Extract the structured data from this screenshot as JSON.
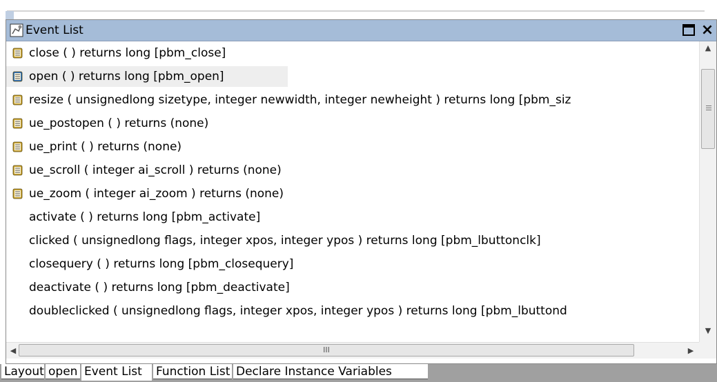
{
  "window": {
    "title": "Event List",
    "maximize_icon": "maximize-icon",
    "close_label": "×"
  },
  "events": [
    {
      "label": "close ( )  returns long [pbm_close]",
      "has_script": true,
      "selected": false
    },
    {
      "label": "open ( )  returns long [pbm_open]",
      "has_script": true,
      "selected": true
    },
    {
      "label": "resize ( unsignedlong sizetype, integer newwidth, integer newheight )  returns long [pbm_siz",
      "has_script": true,
      "selected": false
    },
    {
      "label": "ue_postopen ( ) returns (none)",
      "has_script": true,
      "selected": false
    },
    {
      "label": "ue_print ( ) returns (none)",
      "has_script": true,
      "selected": false
    },
    {
      "label": "ue_scroll ( integer ai_scroll ) returns (none)",
      "has_script": true,
      "selected": false
    },
    {
      "label": "ue_zoom ( integer ai_zoom ) returns (none)",
      "has_script": true,
      "selected": false
    },
    {
      "label": "activate ( )  returns long [pbm_activate]",
      "has_script": false,
      "selected": false
    },
    {
      "label": "clicked ( unsignedlong flags, integer xpos, integer ypos )  returns long [pbm_lbuttonclk]",
      "has_script": false,
      "selected": false
    },
    {
      "label": "closequery ( )  returns long [pbm_closequery]",
      "has_script": false,
      "selected": false
    },
    {
      "label": "deactivate ( )  returns long [pbm_deactivate]",
      "has_script": false,
      "selected": false
    },
    {
      "label": "doubleclicked ( unsignedlong flags, integer xpos, integer ypos )  returns long [pbm_lbuttond",
      "has_script": false,
      "selected": false
    }
  ],
  "scrollbars": {
    "vertical_up": "▲",
    "vertical_down": "▼",
    "horizontal_left": "◀",
    "horizontal_right": "▶",
    "horizontal_grip": "III"
  },
  "tabs": [
    {
      "label": "Layout",
      "active": false
    },
    {
      "label": "open",
      "active": false
    },
    {
      "label": "Event List",
      "active": true
    },
    {
      "label": "Function List",
      "active": false
    },
    {
      "label": "Declare Instance Variables",
      "active": false
    }
  ],
  "colors": {
    "titlebar": "#a5bcd8",
    "selection": "#eeeeee",
    "tabbar": "#a0a0a0",
    "script_icon": "#c7a233",
    "script_icon_selected": "#2d6fb8"
  }
}
